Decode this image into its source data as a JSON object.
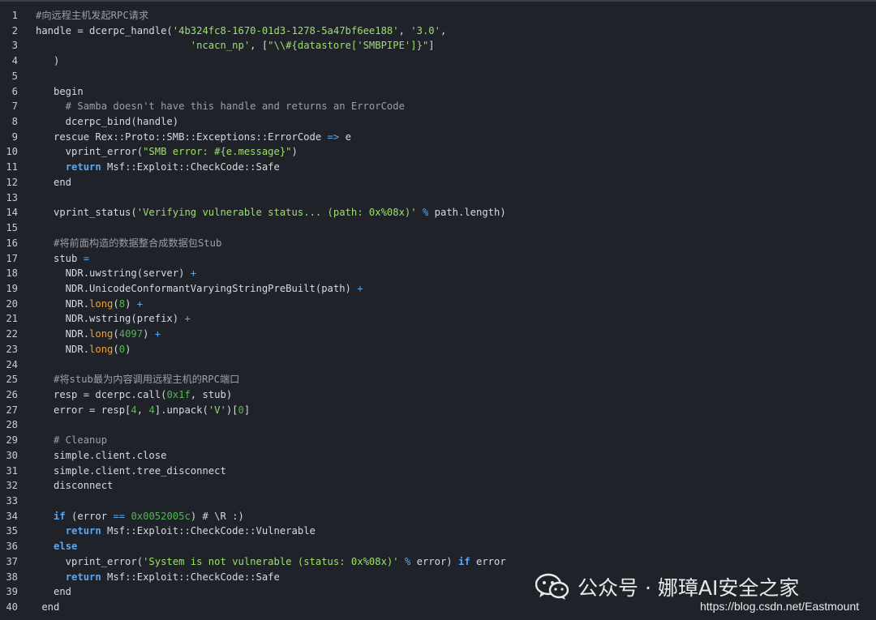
{
  "colors": {
    "background": "#1f2329",
    "line_number": "#c8ccd0",
    "default_text": "#d7dadd",
    "keyword": "#5aa7f0",
    "string": "#9ddf6a",
    "number": "#4fb84f",
    "comment": "#9aa0a6",
    "method_highlight": "#f0a030"
  },
  "watermark": {
    "icon": "wechat-icon",
    "text": "公众号 · 娜璋AI安全之家",
    "url": "https://blog.csdn.net/Eastmount"
  },
  "code_lines": [
    {
      "n": "1",
      "tokens": [
        [
          "cm",
          "#向远程主机发起RPC请求"
        ]
      ]
    },
    {
      "n": "2",
      "tokens": [
        [
          "pl",
          "handle = dcerpc_handle("
        ],
        [
          "str",
          "'4b324fc8-1670-01d3-1278-5a47bf6ee188'"
        ],
        [
          "pl",
          ", "
        ],
        [
          "str",
          "'3.0'"
        ],
        [
          "pl",
          ","
        ]
      ]
    },
    {
      "n": "3",
      "tokens": [
        [
          "pl",
          "                          "
        ],
        [
          "str",
          "'ncacn_np'"
        ],
        [
          "pl",
          ", ["
        ],
        [
          "str",
          "\"\\\\#{datastore['SMBPIPE']}\""
        ],
        [
          "pl",
          "]"
        ]
      ]
    },
    {
      "n": "4",
      "tokens": [
        [
          "pl",
          "   )"
        ]
      ]
    },
    {
      "n": "5",
      "tokens": []
    },
    {
      "n": "6",
      "tokens": [
        [
          "pl",
          "   begin"
        ]
      ]
    },
    {
      "n": "7",
      "tokens": [
        [
          "cm",
          "     # Samba doesn't have this handle and returns an ErrorCode"
        ]
      ]
    },
    {
      "n": "8",
      "tokens": [
        [
          "pl",
          "     dcerpc_bind(handle)"
        ]
      ]
    },
    {
      "n": "9",
      "tokens": [
        [
          "pl",
          "   rescue Rex::Proto::SMB::Exceptions::ErrorCode "
        ],
        [
          "op",
          "=>"
        ],
        [
          "pl",
          " e"
        ]
      ]
    },
    {
      "n": "10",
      "tokens": [
        [
          "pl",
          "     vprint_error("
        ],
        [
          "str",
          "\"SMB error: #{e.message}\""
        ],
        [
          "pl",
          ")"
        ]
      ]
    },
    {
      "n": "11",
      "tokens": [
        [
          "pl",
          "     "
        ],
        [
          "kw",
          "return"
        ],
        [
          "pl",
          " Msf::Exploit::CheckCode::Safe"
        ]
      ]
    },
    {
      "n": "12",
      "tokens": [
        [
          "pl",
          "   end"
        ]
      ]
    },
    {
      "n": "13",
      "tokens": []
    },
    {
      "n": "14",
      "tokens": [
        [
          "pl",
          "   vprint_status("
        ],
        [
          "str",
          "'Verifying vulnerable status... (path: 0x%08x)'"
        ],
        [
          "pl",
          " "
        ],
        [
          "op",
          "%"
        ],
        [
          "pl",
          " path.length)"
        ]
      ]
    },
    {
      "n": "15",
      "tokens": []
    },
    {
      "n": "16",
      "tokens": [
        [
          "cm",
          "   #将前面构造的数据整合成数据包Stub"
        ]
      ]
    },
    {
      "n": "17",
      "tokens": [
        [
          "pl",
          "   stub "
        ],
        [
          "op",
          "="
        ]
      ]
    },
    {
      "n": "18",
      "tokens": [
        [
          "pl",
          "     NDR.uwstring(server) "
        ],
        [
          "op",
          "+"
        ]
      ]
    },
    {
      "n": "19",
      "tokens": [
        [
          "pl",
          "     NDR.UnicodeConformantVaryingStringPreBuilt(path) "
        ],
        [
          "op",
          "+"
        ]
      ]
    },
    {
      "n": "20",
      "tokens": [
        [
          "pl",
          "     NDR."
        ],
        [
          "fn",
          "long"
        ],
        [
          "pl",
          "("
        ],
        [
          "num",
          "8"
        ],
        [
          "pl",
          ") "
        ],
        [
          "op",
          "+"
        ]
      ]
    },
    {
      "n": "21",
      "tokens": [
        [
          "pl",
          "     NDR.wstring(prefix) "
        ],
        [
          "op",
          "+"
        ]
      ]
    },
    {
      "n": "22",
      "tokens": [
        [
          "pl",
          "     NDR."
        ],
        [
          "fn",
          "long"
        ],
        [
          "pl",
          "("
        ],
        [
          "num",
          "4097"
        ],
        [
          "pl",
          ") "
        ],
        [
          "op",
          "+"
        ]
      ]
    },
    {
      "n": "23",
      "tokens": [
        [
          "pl",
          "     NDR."
        ],
        [
          "fn",
          "long"
        ],
        [
          "pl",
          "("
        ],
        [
          "num",
          "0"
        ],
        [
          "pl",
          ")"
        ]
      ]
    },
    {
      "n": "24",
      "tokens": []
    },
    {
      "n": "25",
      "tokens": [
        [
          "cm",
          "   #将stub最为内容调用远程主机的RPC端口"
        ]
      ]
    },
    {
      "n": "26",
      "tokens": [
        [
          "pl",
          "   resp = dcerpc.call("
        ],
        [
          "num",
          "0x1f"
        ],
        [
          "pl",
          ", stub)"
        ]
      ]
    },
    {
      "n": "27",
      "tokens": [
        [
          "pl",
          "   error = resp["
        ],
        [
          "num",
          "4"
        ],
        [
          "pl",
          ", "
        ],
        [
          "num",
          "4"
        ],
        [
          "pl",
          "].unpack("
        ],
        [
          "str",
          "'V'"
        ],
        [
          "pl",
          ")["
        ],
        [
          "num",
          "0"
        ],
        [
          "pl",
          "]"
        ]
      ]
    },
    {
      "n": "28",
      "tokens": []
    },
    {
      "n": "29",
      "tokens": [
        [
          "cm",
          "   # Cleanup"
        ]
      ]
    },
    {
      "n": "30",
      "tokens": [
        [
          "pl",
          "   simple.client.close"
        ]
      ]
    },
    {
      "n": "31",
      "tokens": [
        [
          "pl",
          "   simple.client.tree_disconnect"
        ]
      ]
    },
    {
      "n": "32",
      "tokens": [
        [
          "pl",
          "   disconnect"
        ]
      ]
    },
    {
      "n": "33",
      "tokens": []
    },
    {
      "n": "34",
      "tokens": [
        [
          "pl",
          "   "
        ],
        [
          "kw",
          "if"
        ],
        [
          "pl",
          " (error "
        ],
        [
          "op",
          "=="
        ],
        [
          "pl",
          " "
        ],
        [
          "num",
          "0x0052005c"
        ],
        [
          "pl",
          ") # \\R :)"
        ]
      ]
    },
    {
      "n": "35",
      "tokens": [
        [
          "pl",
          "     "
        ],
        [
          "kw",
          "return"
        ],
        [
          "pl",
          " Msf::Exploit::CheckCode::Vulnerable"
        ]
      ]
    },
    {
      "n": "36",
      "tokens": [
        [
          "pl",
          "   "
        ],
        [
          "kw",
          "else"
        ]
      ]
    },
    {
      "n": "37",
      "tokens": [
        [
          "pl",
          "     vprint_error("
        ],
        [
          "str",
          "'System is not vulnerable (status: 0x%08x)'"
        ],
        [
          "pl",
          " "
        ],
        [
          "op",
          "%"
        ],
        [
          "pl",
          " error) "
        ],
        [
          "kw",
          "if"
        ],
        [
          "pl",
          " error"
        ]
      ]
    },
    {
      "n": "38",
      "tokens": [
        [
          "pl",
          "     "
        ],
        [
          "kw",
          "return"
        ],
        [
          "pl",
          " Msf::Exploit::CheckCode::Safe"
        ]
      ]
    },
    {
      "n": "39",
      "tokens": [
        [
          "pl",
          "   end"
        ]
      ]
    },
    {
      "n": "40",
      "tokens": [
        [
          "pl",
          " end"
        ]
      ]
    }
  ]
}
